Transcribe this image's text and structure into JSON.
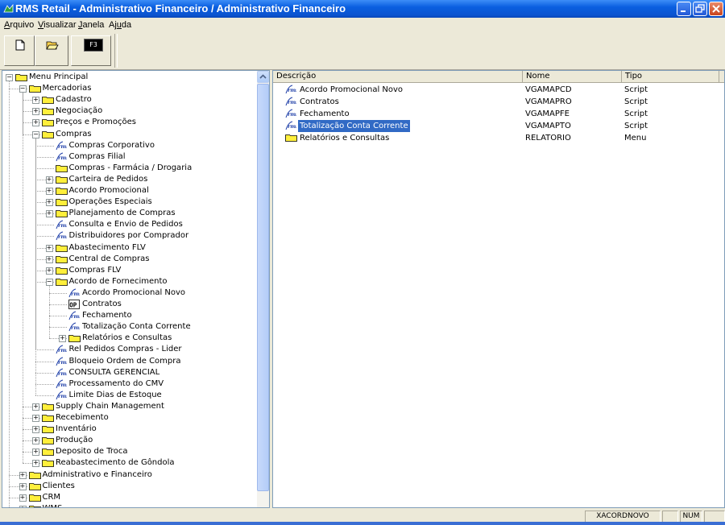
{
  "window": {
    "title": "RMS Retail - Administrativo Financeiro / Administrativo Financeiro"
  },
  "menu": [
    {
      "pre": "",
      "u": "A",
      "post": "rquivo"
    },
    {
      "pre": "",
      "u": "V",
      "post": "isualizar"
    },
    {
      "pre": "",
      "u": "J",
      "post": "anela"
    },
    {
      "pre": "Aj",
      "u": "u",
      "post": "da"
    }
  ],
  "toolbar": {
    "f3_label": "F3"
  },
  "tree": [
    {
      "label": "Menu Principal",
      "depth": 0,
      "icon": "folder",
      "exp": "-"
    },
    {
      "label": "Mercadorias",
      "depth": 1,
      "icon": "folder",
      "exp": "-"
    },
    {
      "label": "Cadastro",
      "depth": 2,
      "icon": "folder",
      "exp": "+"
    },
    {
      "label": "Negociação",
      "depth": 2,
      "icon": "folder",
      "exp": "+"
    },
    {
      "label": "Preços e Promoções",
      "depth": 2,
      "icon": "folder",
      "exp": "+"
    },
    {
      "label": "Compras",
      "depth": 2,
      "icon": "folder",
      "exp": "-"
    },
    {
      "label": "Compras Corporativo",
      "depth": 3,
      "icon": "program",
      "exp": ""
    },
    {
      "label": "Compras Filial",
      "depth": 3,
      "icon": "program",
      "exp": ""
    },
    {
      "label": "Compras - Farmácia / Drogaria",
      "depth": 3,
      "icon": "folder",
      "exp": ""
    },
    {
      "label": "Carteira de Pedidos",
      "depth": 3,
      "icon": "folder",
      "exp": "+"
    },
    {
      "label": "Acordo Promocional",
      "depth": 3,
      "icon": "folder",
      "exp": "+"
    },
    {
      "label": "Operações Especiais",
      "depth": 3,
      "icon": "folder",
      "exp": "+"
    },
    {
      "label": "Planejamento de Compras",
      "depth": 3,
      "icon": "folder",
      "exp": "+"
    },
    {
      "label": "Consulta e Envio de Pedidos",
      "depth": 3,
      "icon": "program",
      "exp": ""
    },
    {
      "label": "Distribuidores por Comprador",
      "depth": 3,
      "icon": "program",
      "exp": ""
    },
    {
      "label": "Abastecimento FLV",
      "depth": 3,
      "icon": "folder",
      "exp": "+"
    },
    {
      "label": "Central de Compras",
      "depth": 3,
      "icon": "folder",
      "exp": "+"
    },
    {
      "label": "Compras FLV",
      "depth": 3,
      "icon": "folder",
      "exp": "+"
    },
    {
      "label": "Acordo de Fornecimento",
      "depth": 3,
      "icon": "folder",
      "exp": "-"
    },
    {
      "label": "Acordo Promocional Novo",
      "depth": 4,
      "icon": "program",
      "exp": ""
    },
    {
      "label": "Contratos",
      "depth": 4,
      "icon": "open",
      "exp": ""
    },
    {
      "label": "Fechamento",
      "depth": 4,
      "icon": "program",
      "exp": ""
    },
    {
      "label": "Totalização Conta Corrente",
      "depth": 4,
      "icon": "program",
      "exp": ""
    },
    {
      "label": "Relatórios e Consultas",
      "depth": 4,
      "icon": "folder",
      "exp": "+"
    },
    {
      "label": "Rel Pedidos Compras - Lider",
      "depth": 3,
      "icon": "program",
      "exp": ""
    },
    {
      "label": "Bloqueio Ordem de Compra",
      "depth": 3,
      "icon": "program",
      "exp": ""
    },
    {
      "label": "CONSULTA GERENCIAL",
      "depth": 3,
      "icon": "program",
      "exp": ""
    },
    {
      "label": "Processamento do CMV",
      "depth": 3,
      "icon": "program",
      "exp": ""
    },
    {
      "label": "Limite Dias de Estoque",
      "depth": 3,
      "icon": "program",
      "exp": ""
    },
    {
      "label": "Supply Chain Management",
      "depth": 2,
      "icon": "folder",
      "exp": "+"
    },
    {
      "label": "Recebimento",
      "depth": 2,
      "icon": "folder",
      "exp": "+"
    },
    {
      "label": "Inventário",
      "depth": 2,
      "icon": "folder",
      "exp": "+"
    },
    {
      "label": "Produção",
      "depth": 2,
      "icon": "folder",
      "exp": "+"
    },
    {
      "label": "Deposito de Troca",
      "depth": 2,
      "icon": "folder",
      "exp": "+"
    },
    {
      "label": "Reabastecimento de Gôndola",
      "depth": 2,
      "icon": "folder",
      "exp": "+"
    },
    {
      "label": "Administrativo e Financeiro",
      "depth": 1,
      "icon": "folder",
      "exp": "+"
    },
    {
      "label": "Clientes",
      "depth": 1,
      "icon": "folder",
      "exp": "+"
    },
    {
      "label": "CRM",
      "depth": 1,
      "icon": "folder",
      "exp": "+"
    },
    {
      "label": "WMS",
      "depth": 1,
      "icon": "folder",
      "exp": "+"
    }
  ],
  "list": {
    "columns": [
      "Descrição",
      "Nome",
      "Tipo"
    ],
    "rows": [
      {
        "descricao": "Acordo Promocional Novo",
        "nome": "VGAMAPCD",
        "tipo": "Script",
        "icon": "program",
        "selected": false
      },
      {
        "descricao": "Contratos",
        "nome": "VGAMAPRO",
        "tipo": "Script",
        "icon": "program",
        "selected": false
      },
      {
        "descricao": "Fechamento",
        "nome": "VGAMAPFE",
        "tipo": "Script",
        "icon": "program",
        "selected": false
      },
      {
        "descricao": "Totalização Conta Corrente",
        "nome": "VGAMAPTO",
        "tipo": "Script",
        "icon": "program",
        "selected": true
      },
      {
        "descricao": "Relatórios e Consultas",
        "nome": "RELATORIO",
        "tipo": "Menu",
        "icon": "folder",
        "selected": false
      }
    ]
  },
  "status": {
    "user": "XACORDNOVO",
    "num": "NUM"
  }
}
